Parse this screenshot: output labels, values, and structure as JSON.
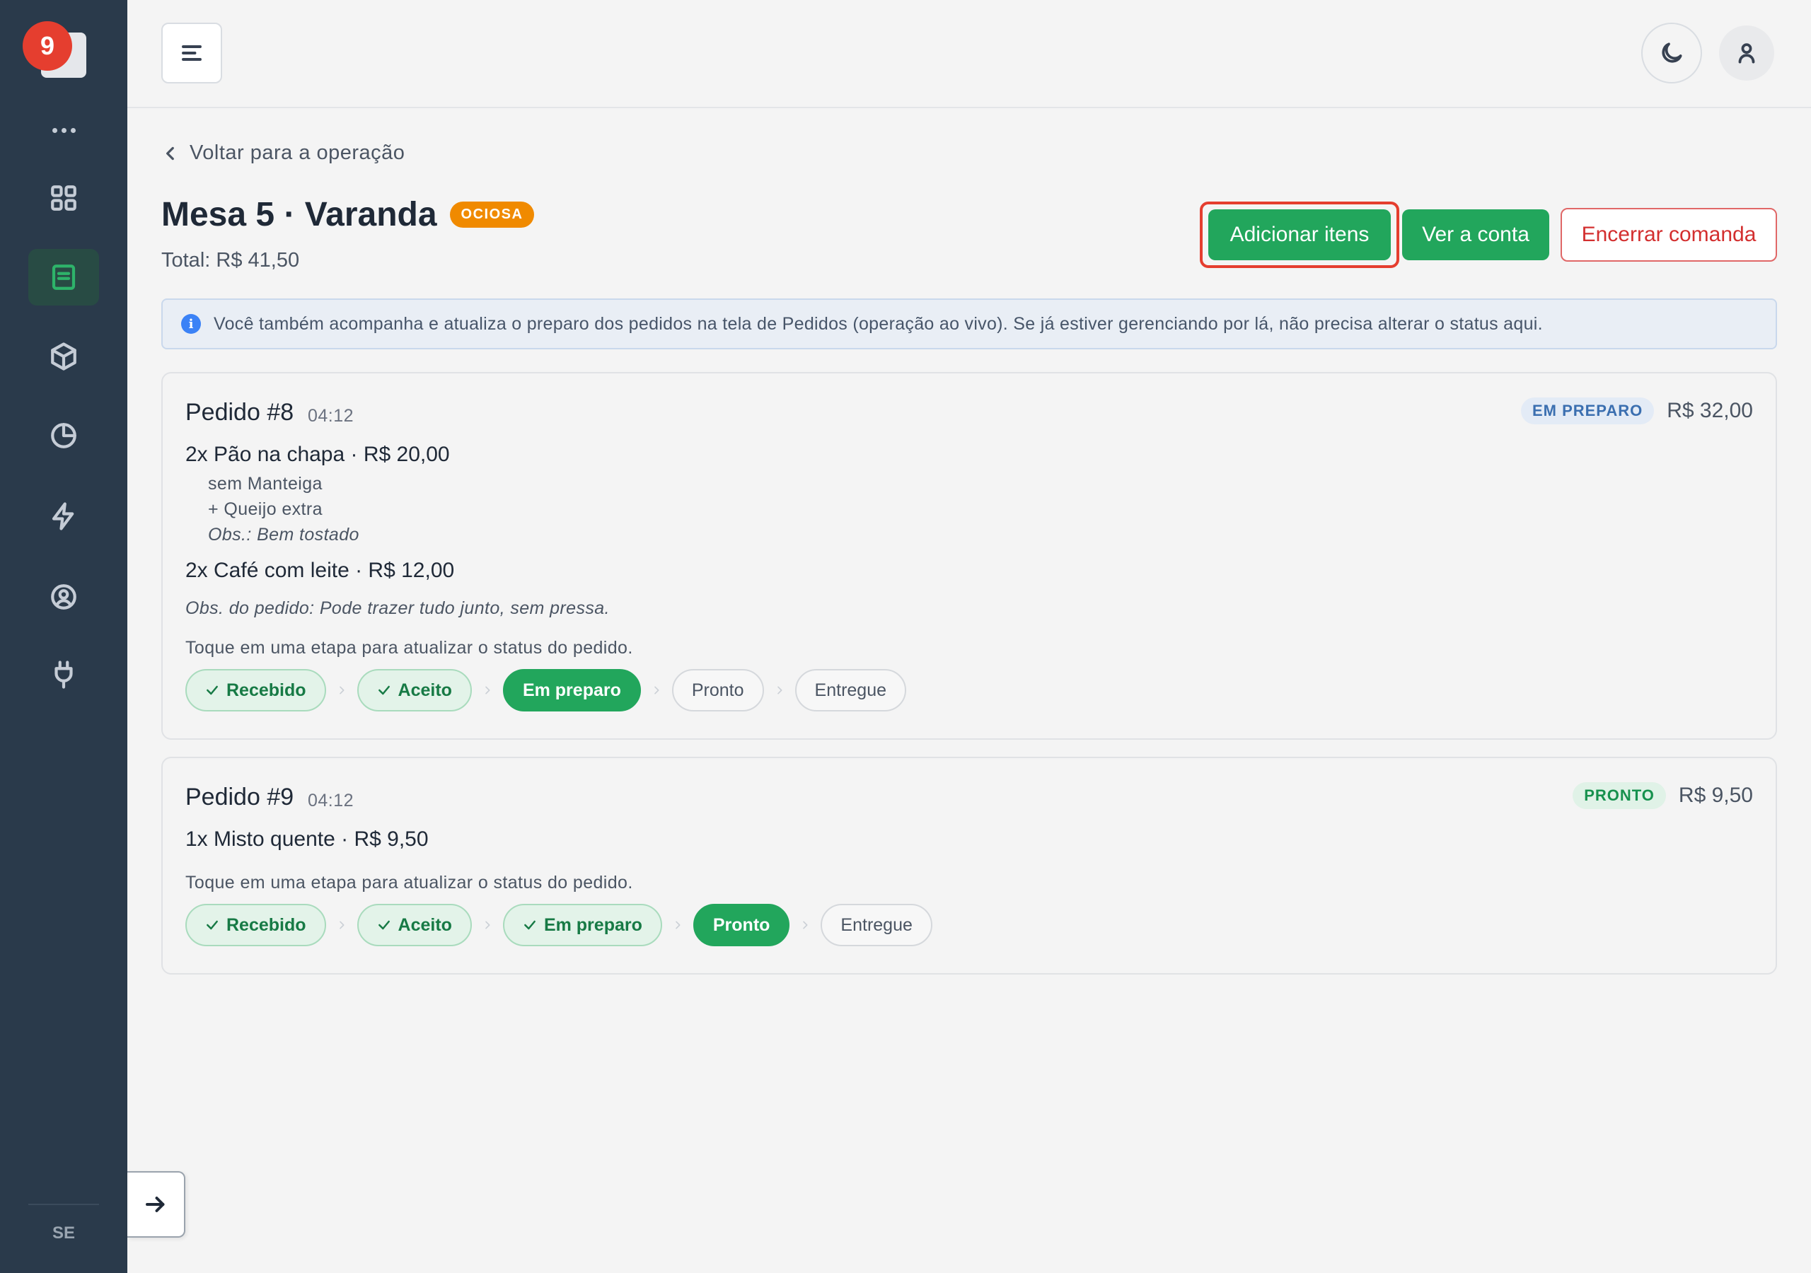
{
  "sidebar": {
    "notification_count": "9",
    "items": [
      {
        "name": "grid-icon"
      },
      {
        "name": "list-icon",
        "active": true
      },
      {
        "name": "box-icon"
      },
      {
        "name": "pie-chart-icon"
      },
      {
        "name": "lightning-icon"
      },
      {
        "name": "user-circle-icon"
      },
      {
        "name": "plug-icon"
      }
    ],
    "footer": "SE"
  },
  "header": {
    "menu_icon": "menu-icon",
    "theme_icon": "moon-icon",
    "user_icon": "user-icon"
  },
  "main": {
    "back_link": "Voltar para a operação",
    "title": "Mesa 5 · Varanda",
    "status": "OCIOSA",
    "total": "Total: R$ 41,50",
    "buttons": {
      "add_items": "Adicionar itens",
      "view_bill": "Ver a conta",
      "close_tab": "Encerrar comanda"
    },
    "info": "Você também acompanha e atualiza o preparo dos pedidos na tela de Pedidos (operação ao vivo). Se já estiver gerenciando por lá, não precisa alterar o status aqui.",
    "orders": [
      {
        "title": "Pedido #8",
        "time": "04:12",
        "status": "EM PREPARO",
        "price": "R$ 32,00",
        "items": [
          {
            "line": "2x Pão na chapa · R$ 20,00",
            "mods": [
              "sem Manteiga",
              "+ Queijo extra"
            ],
            "obs": "Obs.: Bem tostado"
          },
          {
            "line": "2x Café com leite · R$ 12,00"
          }
        ],
        "order_obs": "Obs. do pedido: Pode trazer tudo junto, sem pressa.",
        "hint": "Toque em uma etapa para atualizar o status do pedido.",
        "steps": [
          "Recebido",
          "Aceito",
          "Em preparo",
          "Pronto",
          "Entregue"
        ]
      },
      {
        "title": "Pedido #9",
        "time": "04:12",
        "status": "PRONTO",
        "price": "R$ 9,50",
        "items": [
          {
            "line": "1x Misto quente · R$ 9,50"
          }
        ],
        "hint": "Toque em uma etapa para atualizar o status do pedido.",
        "steps": [
          "Recebido",
          "Aceito",
          "Em preparo",
          "Pronto",
          "Entregue"
        ]
      }
    ]
  },
  "colors": {
    "sidebar_bg": "#2a3a4b",
    "accent_green": "#22a65c",
    "danger_red": "#d32f2f",
    "warning_orange": "#f08a00",
    "info_blue": "#3b82f6"
  }
}
